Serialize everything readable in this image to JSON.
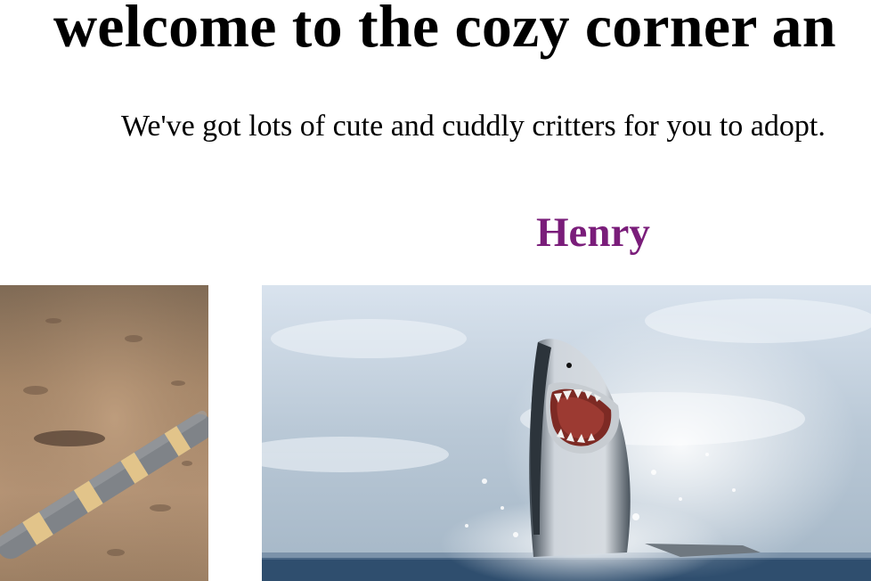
{
  "header": {
    "title": "welcome to the cozy corner an"
  },
  "intro": {
    "text": "We've got lots of cute and cuddly critters for you to adopt."
  },
  "pets": [
    {
      "name": "Henry"
    }
  ],
  "colors": {
    "pet_name": "#7a1d7a",
    "text": "#000000",
    "background": "#ffffff"
  }
}
